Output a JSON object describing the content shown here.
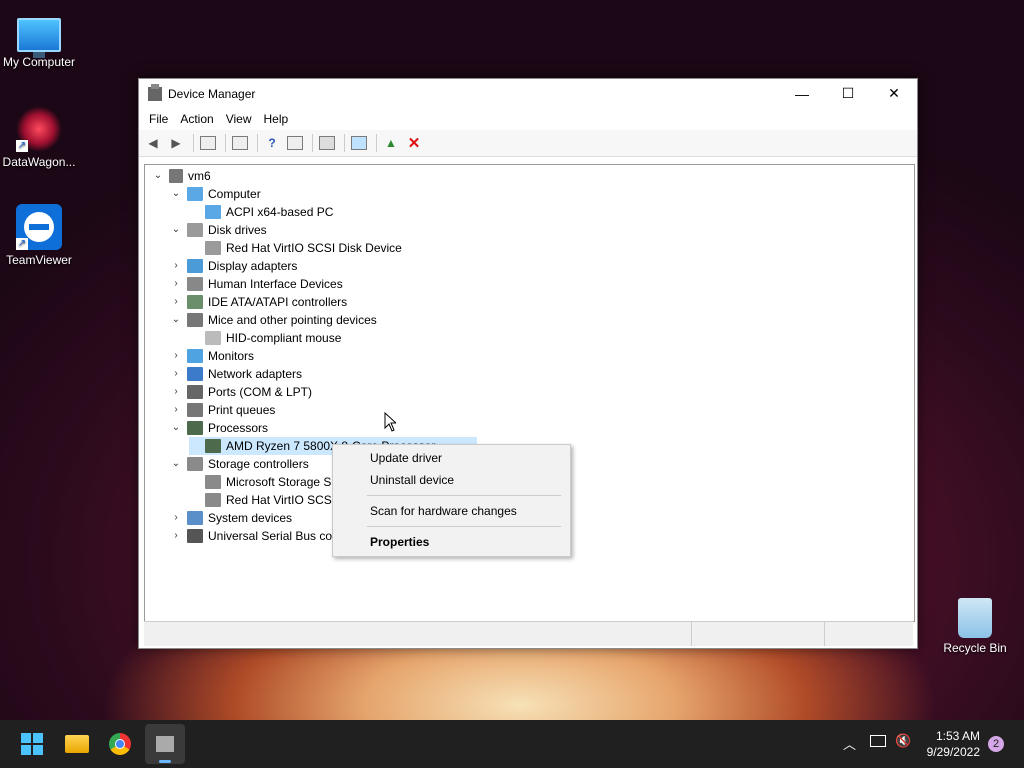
{
  "desktop": {
    "icons": [
      {
        "label": "My Computer"
      },
      {
        "label": "DataWagon..."
      },
      {
        "label": "TeamViewer"
      },
      {
        "label": "Recycle Bin"
      }
    ]
  },
  "window": {
    "title": "Device Manager",
    "controls": {
      "minimize": "—",
      "maximize": "☐",
      "close": "✕"
    },
    "menu": [
      "File",
      "Action",
      "View",
      "Help"
    ]
  },
  "tree": {
    "root": "vm6",
    "nodes": [
      {
        "label": "Computer",
        "expanded": true,
        "depth": 1
      },
      {
        "label": "ACPI x64-based PC",
        "depth": 2
      },
      {
        "label": "Disk drives",
        "expanded": true,
        "depth": 1
      },
      {
        "label": "Red Hat VirtIO SCSI Disk Device",
        "depth": 2
      },
      {
        "label": "Display adapters",
        "expanded": false,
        "depth": 1
      },
      {
        "label": "Human Interface Devices",
        "expanded": false,
        "depth": 1
      },
      {
        "label": "IDE ATA/ATAPI controllers",
        "expanded": false,
        "depth": 1
      },
      {
        "label": "Mice and other pointing devices",
        "expanded": true,
        "depth": 1
      },
      {
        "label": "HID-compliant mouse",
        "depth": 2
      },
      {
        "label": "Monitors",
        "expanded": false,
        "depth": 1
      },
      {
        "label": "Network adapters",
        "expanded": false,
        "depth": 1
      },
      {
        "label": "Ports (COM & LPT)",
        "expanded": false,
        "depth": 1
      },
      {
        "label": "Print queues",
        "expanded": false,
        "depth": 1
      },
      {
        "label": "Processors",
        "expanded": true,
        "depth": 1
      },
      {
        "label": "AMD Ryzen 7 5800X 8-Core Processor",
        "depth": 2,
        "selected": true
      },
      {
        "label": "Storage controllers",
        "expanded": true,
        "depth": 1
      },
      {
        "label": "Microsoft Storage Spaces Controller",
        "depth": 2
      },
      {
        "label": "Red Hat VirtIO SCSI controller",
        "depth": 2
      },
      {
        "label": "System devices",
        "expanded": false,
        "depth": 1
      },
      {
        "label": "Universal Serial Bus controllers",
        "expanded": false,
        "depth": 1
      }
    ]
  },
  "context_menu": {
    "items": [
      "Update driver",
      "Uninstall device",
      "Scan for hardware changes",
      "Properties"
    ]
  },
  "taskbar": {
    "time": "1:53 AM",
    "date": "9/29/2022",
    "notification_count": "2"
  }
}
